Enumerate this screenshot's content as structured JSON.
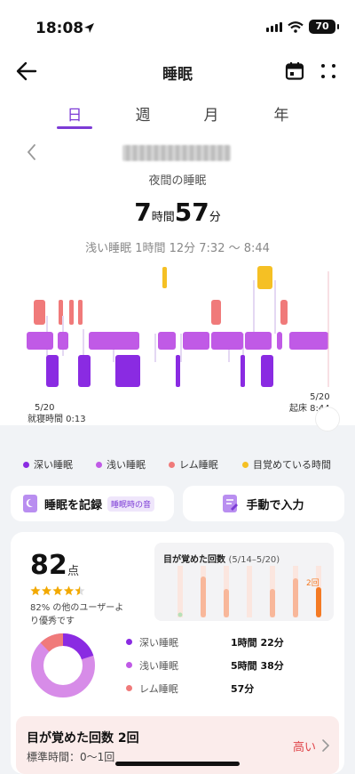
{
  "status_bar": {
    "time": "18:08",
    "battery": "70"
  },
  "header": {
    "title": "睡眠"
  },
  "tabs": [
    {
      "label": "日",
      "active": true
    },
    {
      "label": "週",
      "active": false
    },
    {
      "label": "月",
      "active": false
    },
    {
      "label": "年",
      "active": false
    }
  ],
  "sleep": {
    "night_label": "夜間の睡眠",
    "hours": "7",
    "hours_unit": "時間",
    "minutes": "57",
    "minutes_unit": "分",
    "selected_stage_info": "浅い睡眠 1時間 12分 7:32 〜 8:44",
    "bedtime_date": "5/20",
    "bedtime_label": "就寝時間 0:13",
    "wake_date": "5/20",
    "wake_label": "起床 8:44"
  },
  "colors": {
    "deep": "#8a2be2",
    "light": "#c05ae6",
    "rem": "#f07a7a",
    "awake": "#f5c024",
    "accent": "#7c3bd6"
  },
  "legend": [
    {
      "label": "深い睡眠",
      "color": "#8a2be2"
    },
    {
      "label": "浅い睡眠",
      "color": "#c05ae6"
    },
    {
      "label": "レム睡眠",
      "color": "#f07a7a"
    },
    {
      "label": "目覚めている時間",
      "color": "#f5c024"
    }
  ],
  "actions": {
    "record_label": "睡眠を記録",
    "record_badge": "睡眠時の音",
    "manual_label": "手動で入力"
  },
  "score": {
    "value": "82",
    "unit": "点",
    "stars": 4.5,
    "description": "82% の他のユーザーより優秀です"
  },
  "wake_chart": {
    "title": "目が覚めた回数",
    "range": "(5/14–5/20)",
    "values": [
      0,
      3,
      2,
      0,
      2,
      3,
      2
    ],
    "highlight_label": "2回"
  },
  "breakdown": [
    {
      "name": "深い睡眠",
      "value": "1時間 22分",
      "color": "#8a2be2"
    },
    {
      "name": "浅い睡眠",
      "value": "5時間 38分",
      "color": "#c05ae6"
    },
    {
      "name": "レム睡眠",
      "value": "57分",
      "color": "#f07a7a"
    }
  ],
  "alert": {
    "title": "目が覚めた回数 2回",
    "standard": "標準時間：0〜1回",
    "level": "高い"
  }
}
